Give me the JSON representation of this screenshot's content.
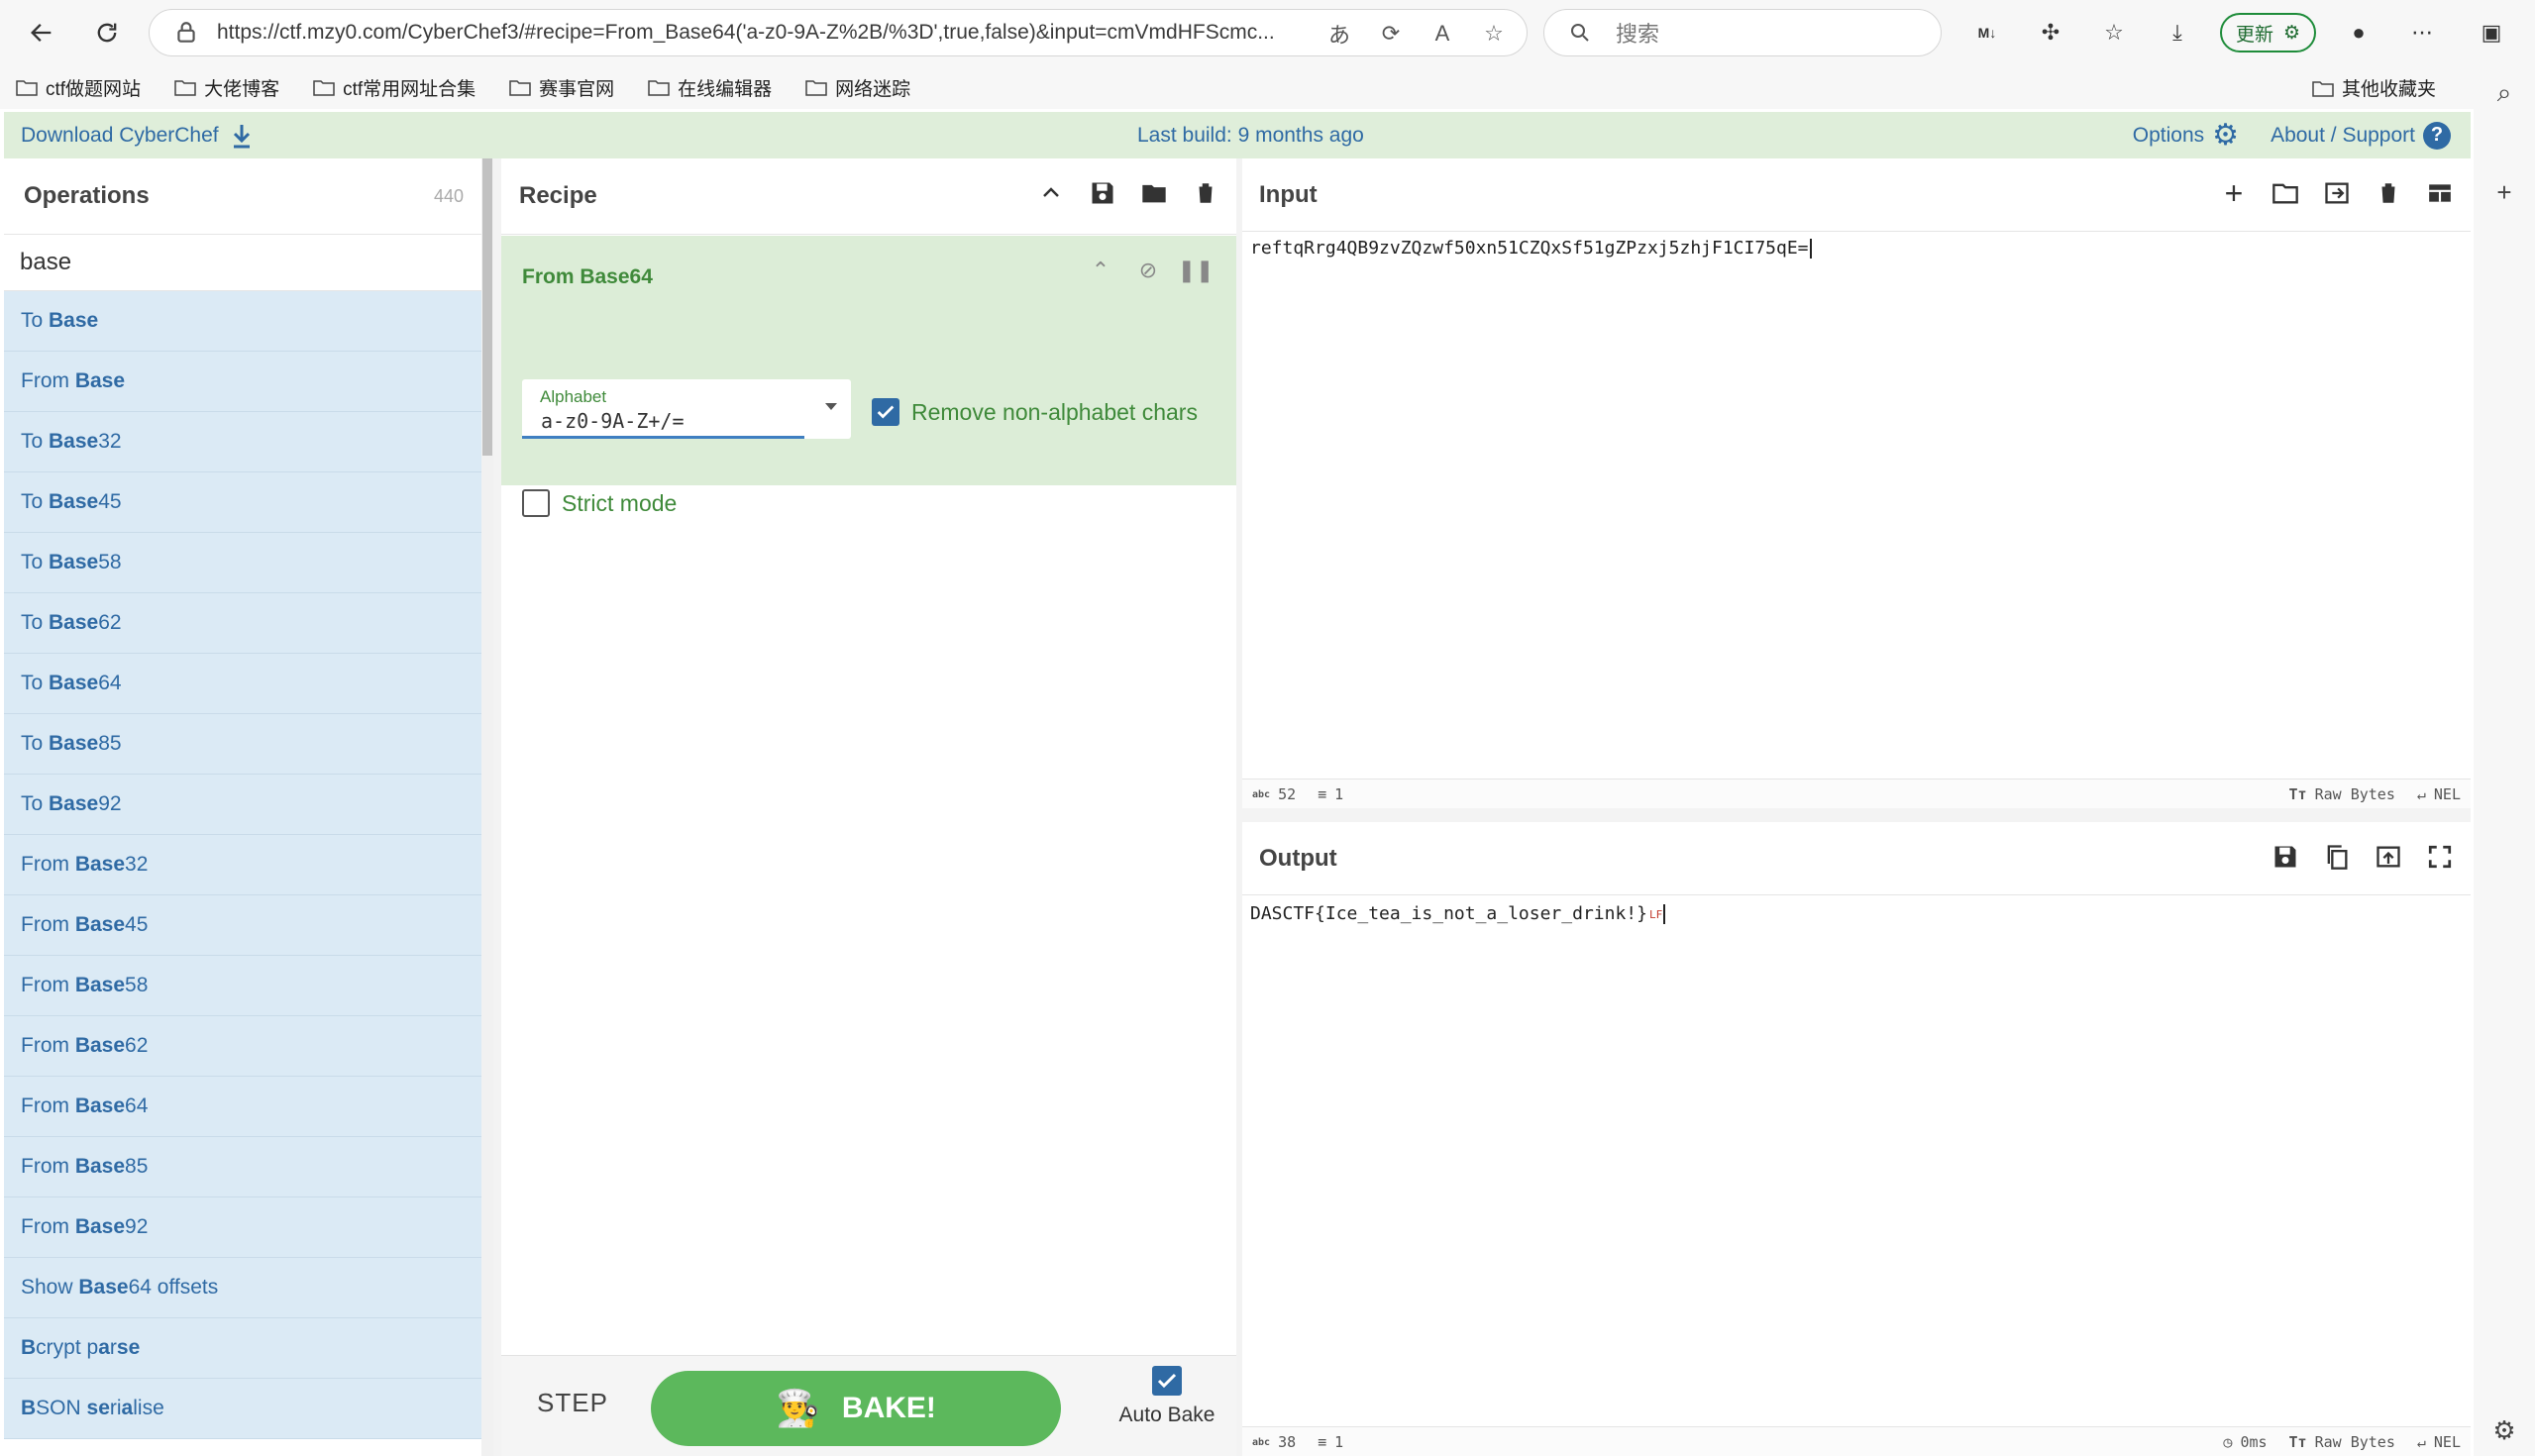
{
  "browser": {
    "url": "https://ctf.mzy0.com/CyberChef3/#recipe=From_Base64('a-z0-9A-Z%2B/%3D',true,false)&input=cmVmdHFScmc...",
    "search_placeholder": "搜索",
    "update_label": "更新",
    "bookmarks": [
      "ctf做题网站",
      "大佬博客",
      "ctf常用网址合集",
      "赛事官网",
      "在线编辑器",
      "网络迷踪"
    ],
    "other_bookmarks": "其他收藏夹"
  },
  "banner": {
    "download": "Download CyberChef",
    "last_build": "Last build: 9 months ago",
    "options": "Options",
    "about": "About / Support"
  },
  "operations": {
    "title": "Operations",
    "count": "440",
    "search": "base",
    "items": [
      {
        "pre": "To ",
        "bold": "Base",
        "post": ""
      },
      {
        "pre": "From ",
        "bold": "Base",
        "post": ""
      },
      {
        "pre": "To ",
        "bold": "Base",
        "post": "32"
      },
      {
        "pre": "To ",
        "bold": "Base",
        "post": "45"
      },
      {
        "pre": "To ",
        "bold": "Base",
        "post": "58"
      },
      {
        "pre": "To ",
        "bold": "Base",
        "post": "62"
      },
      {
        "pre": "To ",
        "bold": "Base",
        "post": "64"
      },
      {
        "pre": "To ",
        "bold": "Base",
        "post": "85"
      },
      {
        "pre": "To ",
        "bold": "Base",
        "post": "92"
      },
      {
        "pre": "From ",
        "bold": "Base",
        "post": "32"
      },
      {
        "pre": "From ",
        "bold": "Base",
        "post": "45"
      },
      {
        "pre": "From ",
        "bold": "Base",
        "post": "58"
      },
      {
        "pre": "From ",
        "bold": "Base",
        "post": "62"
      },
      {
        "pre": "From ",
        "bold": "Base",
        "post": "64"
      },
      {
        "pre": "From ",
        "bold": "Base",
        "post": "85"
      },
      {
        "pre": "From ",
        "bold": "Base",
        "post": "92"
      },
      {
        "pre": "Show ",
        "bold": "Base",
        "post": "64 offsets"
      },
      {
        "pre": "",
        "bold": "B",
        "post": "crypt p",
        "bold2": "a",
        "post2": "r",
        "bold3": "se",
        "post3": ""
      },
      {
        "pre": "",
        "bold": "B",
        "post": "SON ",
        "bold2": "se",
        "post2": "ri",
        "bold3": "a",
        "post3": "lise"
      }
    ]
  },
  "recipe": {
    "title": "Recipe",
    "operation": {
      "name": "From Base64",
      "alphabet_label": "Alphabet",
      "alphabet_value": "a-z0-9A-Z+/=",
      "remove_non_alpha_label": "Remove non-alphabet chars",
      "remove_non_alpha": true,
      "strict_mode_label": "Strict mode",
      "strict_mode": false
    },
    "step_label": "STEP",
    "bake_label": "BAKE!",
    "autobake_label": "Auto Bake",
    "autobake": true
  },
  "input": {
    "title": "Input",
    "text": "reftqRrg4QB9zvZQzwf50xn51CZQxSf51gZPzxj5zhjF1CI75qE=",
    "length": "52",
    "lines": "1",
    "encoding": "Raw Bytes",
    "eol": "NEL"
  },
  "output": {
    "title": "Output",
    "text": "DASCTF{Ice_tea_is_not_a_loser_drink!}",
    "lf_marker": "LF",
    "length": "38",
    "lines": "1",
    "time": "0ms",
    "encoding": "Raw Bytes",
    "eol": "NEL"
  },
  "colors": {
    "link_blue": "#2f6aa4",
    "recipe_green": "#3f8a3a",
    "bake_green": "#5cb85c",
    "op_item_bg": "#dbeaf5"
  }
}
